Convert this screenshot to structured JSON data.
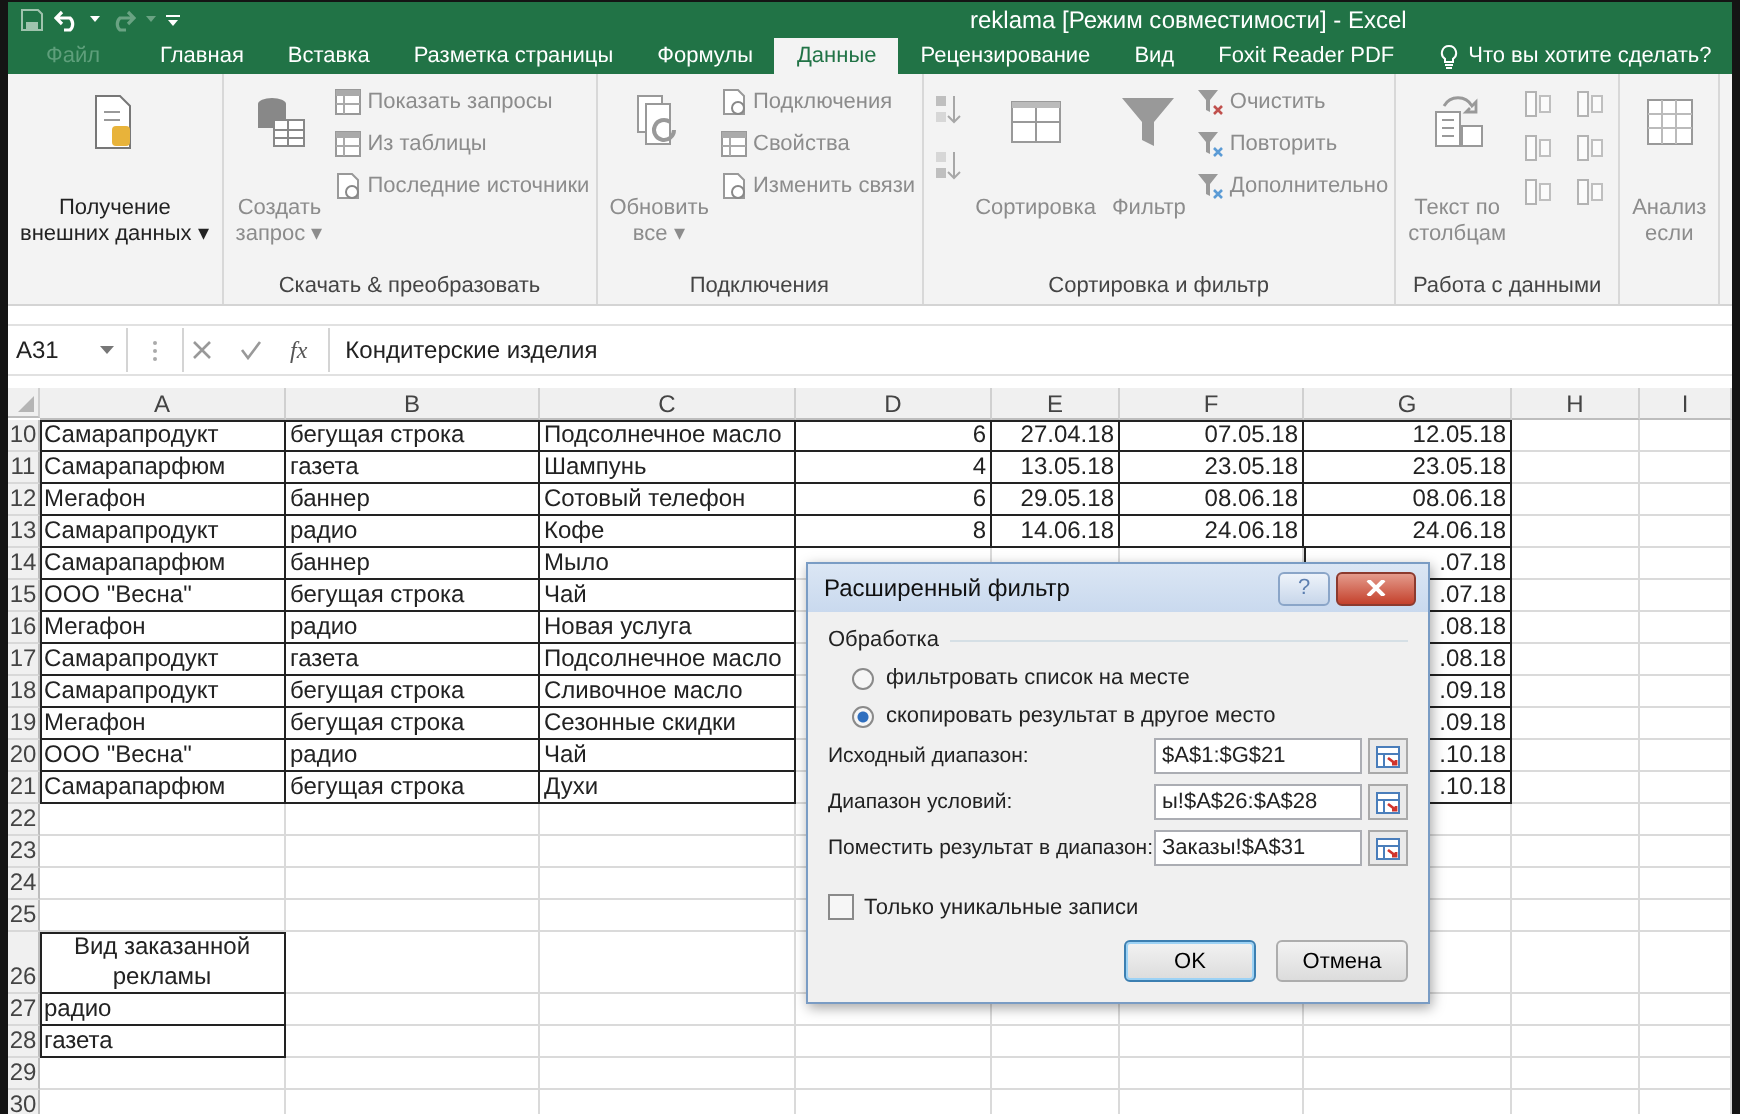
{
  "window": {
    "title": "reklama  [Режим совместимости] - Excel"
  },
  "tabs": [
    {
      "label": "Файл",
      "kind": "file",
      "selected": false
    },
    {
      "label": "Главная",
      "kind": "tab",
      "selected": false
    },
    {
      "label": "Вставка",
      "kind": "tab",
      "selected": false
    },
    {
      "label": "Разметка страницы",
      "kind": "tab",
      "selected": false
    },
    {
      "label": "Формулы",
      "kind": "tab",
      "selected": false
    },
    {
      "label": "Данные",
      "kind": "tab",
      "selected": true
    },
    {
      "label": "Рецензирование",
      "kind": "tab",
      "selected": false
    },
    {
      "label": "Вид",
      "kind": "tab",
      "selected": false
    },
    {
      "label": "Foxit Reader PDF",
      "kind": "tab",
      "selected": false
    }
  ],
  "tell_me": "Что вы хотите сделать?",
  "ribbon": {
    "groups": [
      {
        "items": [
          {
            "kind": "large",
            "lines": [
              "Получение",
              "внешних данных ▾"
            ],
            "disabled": false
          }
        ]
      },
      {
        "label": "Скачать & преобразовать",
        "items": [
          {
            "kind": "large",
            "lines": [
              "Создать",
              "запрос ▾"
            ],
            "disabled": true
          },
          {
            "kind": "stack",
            "items": [
              {
                "label": "Показать запросы",
                "disabled": true
              },
              {
                "label": "Из таблицы",
                "disabled": true
              },
              {
                "label": "Последние источники",
                "disabled": true
              }
            ]
          }
        ]
      },
      {
        "label": "Подключения",
        "items": [
          {
            "kind": "large",
            "lines": [
              "Обновить",
              "все ▾"
            ],
            "disabled": true
          },
          {
            "kind": "stack",
            "items": [
              {
                "label": "Подключения",
                "disabled": true
              },
              {
                "label": "Свойства",
                "disabled": true
              },
              {
                "label": "Изменить связи",
                "disabled": true
              }
            ]
          }
        ]
      },
      {
        "label": "Сортировка и фильтр",
        "items": [
          {
            "kind": "sort-icons",
            "disabled": true
          },
          {
            "kind": "large",
            "lines": [
              "Сортировка"
            ],
            "disabled": true
          },
          {
            "kind": "large",
            "lines": [
              "Фильтр"
            ],
            "disabled": true
          },
          {
            "kind": "stack",
            "items": [
              {
                "label": "Очистить",
                "disabled": true
              },
              {
                "label": "Повторить",
                "disabled": true
              },
              {
                "label": "Дополнительно",
                "disabled": true
              }
            ]
          }
        ]
      },
      {
        "label": "Работа с данными",
        "items": [
          {
            "kind": "large",
            "lines": [
              "Текст по",
              "столбцам"
            ],
            "disabled": true
          },
          {
            "kind": "tool-icons",
            "disabled": true
          }
        ]
      },
      {
        "items": [
          {
            "kind": "large",
            "lines": [
              "Анализ",
              "если"
            ],
            "disabled": true
          }
        ]
      }
    ]
  },
  "formula_bar": {
    "name_box": "A31",
    "insert_function": "fx",
    "formula": "Кондитерские изделия"
  },
  "sheet": {
    "columns": [
      "A",
      "B",
      "C",
      "D",
      "E",
      "F",
      "G",
      "H",
      "I"
    ],
    "rows": [
      {
        "number": "10",
        "kind": "data",
        "cells": {
          "a": "Самарапродукт",
          "b": "бегущая строка",
          "c": "Подсолнечное масло",
          "d": "6",
          "e": "27.04.18",
          "f": "07.05.18",
          "g": "12.05.18"
        }
      },
      {
        "number": "11",
        "kind": "data",
        "cells": {
          "a": "Самарапарфюм",
          "b": "газета",
          "c": "Шампунь",
          "d": "4",
          "e": "13.05.18",
          "f": "23.05.18",
          "g": "23.05.18"
        }
      },
      {
        "number": "12",
        "kind": "data",
        "cells": {
          "a": "Мегафон",
          "b": "баннер",
          "c": "Сотовый телефон",
          "d": "6",
          "e": "29.05.18",
          "f": "08.06.18",
          "g": "08.06.18"
        }
      },
      {
        "number": "13",
        "kind": "data",
        "cells": {
          "a": "Самарапродукт",
          "b": "радио",
          "c": "Кофе",
          "d": "8",
          "e": "14.06.18",
          "f": "24.06.18",
          "g": "24.06.18"
        }
      },
      {
        "number": "14",
        "kind": "data",
        "cells": {
          "a": "Самарапарфюм",
          "b": "баннер",
          "c": "Мыло",
          "g": ".07.18"
        }
      },
      {
        "number": "15",
        "kind": "data",
        "cells": {
          "a": "ООО \"Весна\"",
          "b": "бегущая строка",
          "c": "Чай",
          "g": ".07.18"
        }
      },
      {
        "number": "16",
        "kind": "data",
        "cells": {
          "a": "Мегафон",
          "b": "радио",
          "c": "Новая услуга",
          "g": ".08.18"
        }
      },
      {
        "number": "17",
        "kind": "data",
        "cells": {
          "a": "Самарапродукт",
          "b": "газета",
          "c": "Подсолнечное масло",
          "g": ".08.18"
        }
      },
      {
        "number": "18",
        "kind": "data",
        "cells": {
          "a": "Самарапродукт",
          "b": "бегущая строка",
          "c": "Сливочное масло",
          "g": ".09.18"
        }
      },
      {
        "number": "19",
        "kind": "data",
        "cells": {
          "a": "Мегафон",
          "b": "бегущая строка",
          "c": "Сезонные скидки",
          "g": ".09.18"
        }
      },
      {
        "number": "20",
        "kind": "data",
        "cells": {
          "a": "ООО \"Весна\"",
          "b": "радио",
          "c": "Чай",
          "g": ".10.18"
        }
      },
      {
        "number": "21",
        "kind": "data",
        "cells": {
          "a": "Самарапарфюм",
          "b": "бегущая строка",
          "c": "Духи",
          "g": ".10.18"
        }
      },
      {
        "number": "22",
        "kind": "data",
        "cells": {}
      },
      {
        "number": "23",
        "kind": "data",
        "cells": {}
      },
      {
        "number": "24",
        "kind": "data",
        "cells": {}
      },
      {
        "number": "25",
        "kind": "data",
        "cells": {}
      },
      {
        "number": "26",
        "kind": "criteria-header",
        "cells": {
          "a": "Вид заказанной рекламы"
        }
      },
      {
        "number": "27",
        "kind": "data",
        "cells": {
          "a": "радио"
        }
      },
      {
        "number": "28",
        "kind": "data",
        "cells": {
          "a": "газета"
        }
      },
      {
        "number": "29",
        "kind": "data",
        "cells": {}
      },
      {
        "number": "30",
        "kind": "data",
        "cells": {}
      }
    ]
  },
  "dialog": {
    "title": "Расширенный фильтр",
    "help_button": "?",
    "group_label": "Обработка",
    "options": [
      {
        "label": "фильтровать список на месте",
        "selected": false
      },
      {
        "label": "скопировать результат в другое место",
        "selected": true
      }
    ],
    "fields": [
      {
        "label": "Исходный диапазон:",
        "value": "$A$1:$G$21"
      },
      {
        "label": "Диапазон условий:",
        "value": "ы!$A$26:$A$28"
      },
      {
        "label": "Поместить результат в диапазон:",
        "value": "Заказы!$A$31"
      }
    ],
    "unique_only": {
      "label": "Только уникальные записи",
      "checked": false
    },
    "buttons": [
      {
        "label": "OK",
        "kind": "default"
      },
      {
        "label": "Отмена",
        "kind": "normal"
      }
    ]
  }
}
